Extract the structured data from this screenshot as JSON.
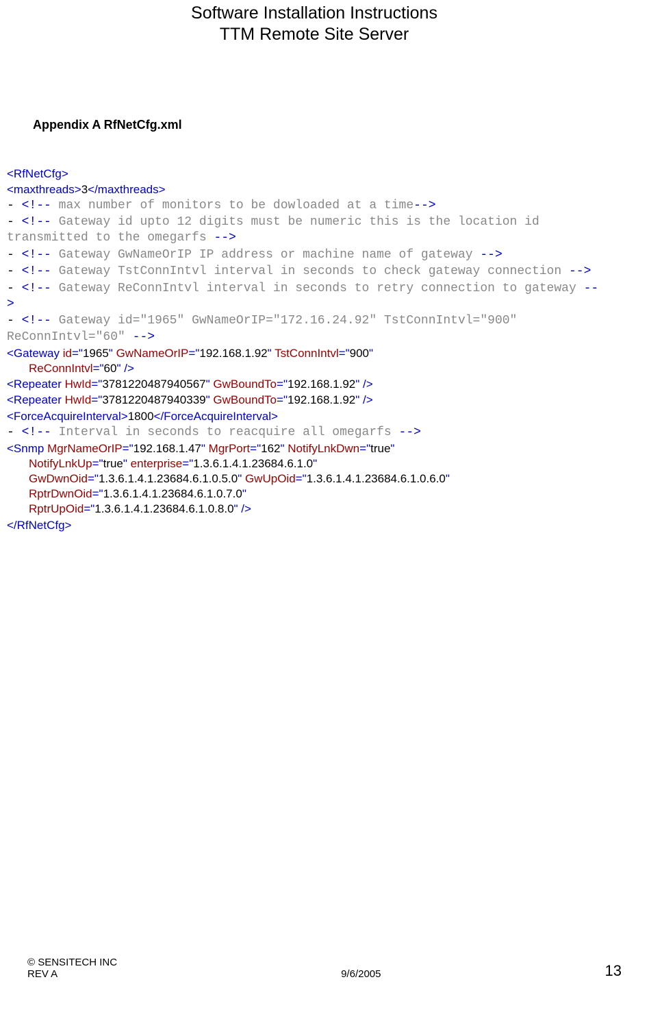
{
  "header": {
    "line1": "Software Installation Instructions",
    "line2": "TTM Remote Site Server"
  },
  "appendix": "Appendix A  RfNetCfg.xml",
  "xml": {
    "rootOpen": "<RfNetCfg>",
    "maxthreads": {
      "open": "<maxthreads>",
      "val": "3",
      "close": "</maxthreads>"
    },
    "comment1": {
      "dash": "-",
      "open": "<!--",
      "text": " max number of monitors to be dowloaded at a time",
      "close": "-->"
    },
    "comment2": {
      "dash": "-",
      "open": "<!--",
      "text": " Gateway id upto 12 digits must be numeric this is the location id transmitted to the omegarfs  ",
      "close": "-->"
    },
    "comment3": {
      "dash": "-",
      "open": "<!--",
      "text": " Gateway GwNameOrIP IP address or machine name of gateway  ",
      "close": "-->"
    },
    "comment4": {
      "dash": "-",
      "open": "<!--",
      "text": " Gateway TstConnIntvl interval in seconds to check gateway connection ",
      "close": "-->"
    },
    "comment5": {
      "dash": "-",
      "open": "<!--",
      "text": " Gateway ReConnIntvl interval in seconds to retry connection to gateway ",
      "close": "-->"
    },
    "comment6": {
      "dash": "-",
      "open": "<!--",
      "text": " Gateway id=\"1965\" GwNameOrIP=\"172.16.24.92\" TstConnIntvl=\"900\" ReConnIntvl=\"60\" ",
      "close": "-->"
    },
    "gateway": {
      "open": "<Gateway",
      "id_attr": " id",
      "id_val": "1965",
      "gw_attr": " GwNameOrIP",
      "gw_val": "192.168.1.92",
      "tst_attr": " TstConnIntvl",
      "tst_val": "900",
      "re_attr": "ReConnIntvl",
      "re_val": "60",
      "close": " />"
    },
    "repeater1": {
      "open": "<Repeater",
      "hw_attr": " HwId",
      "hw_val": "3781220487940567",
      "gw_attr": " GwBoundTo",
      "gw_val": "192.168.1.92",
      "close": " />"
    },
    "repeater2": {
      "open": "<Repeater",
      "hw_attr": " HwId",
      "hw_val": "3781220487940339",
      "gw_attr": " GwBoundTo",
      "gw_val": "192.168.1.92",
      "close": " />"
    },
    "fai": {
      "open": "<ForceAcquireInterval>",
      "val": "1800",
      "close": "</ForceAcquireInterval>"
    },
    "comment7": {
      "dash": "-",
      "open": "<!--",
      "text": " Interval in seconds to reacquire all omegarfs ",
      "close": "-->"
    },
    "snmp": {
      "open": "<Snmp",
      "mgrname_attr": " MgrNameOrIP",
      "mgrname_val": "192.168.1.47",
      "mgrport_attr": " MgrPort",
      "mgrport_val": "162",
      "nld_attr": " NotifyLnkDwn",
      "nld_val": "true",
      "nlu_attr": "NotifyLnkUp",
      "nlu_val": "true",
      "ent_attr": " enterprise",
      "ent_val": "1.3.6.1.4.1.23684.6.1.0",
      "gwdn_attr": "GwDwnOid",
      "gwdn_val": "1.3.6.1.4.1.23684.6.1.0.5.0",
      "gwup_attr": " GwUpOid",
      "gwup_val": "1.3.6.1.4.1.23684.6.1.0.6.0",
      "rpdn_attr": "RptrDwnOid",
      "rpdn_val": "1.3.6.1.4.1.23684.6.1.0.7.0",
      "rpup_attr": "RptrUpOid",
      "rpup_val": "1.3.6.1.4.1.23684.6.1.0.8.0",
      "close": " />"
    },
    "rootClose": "</RfNetCfg>",
    "eq": "=",
    "q": "\""
  },
  "footer": {
    "copyright": "© SENSITECH INC",
    "rev": "REV A",
    "date": "9/6/2005",
    "page": "13"
  }
}
